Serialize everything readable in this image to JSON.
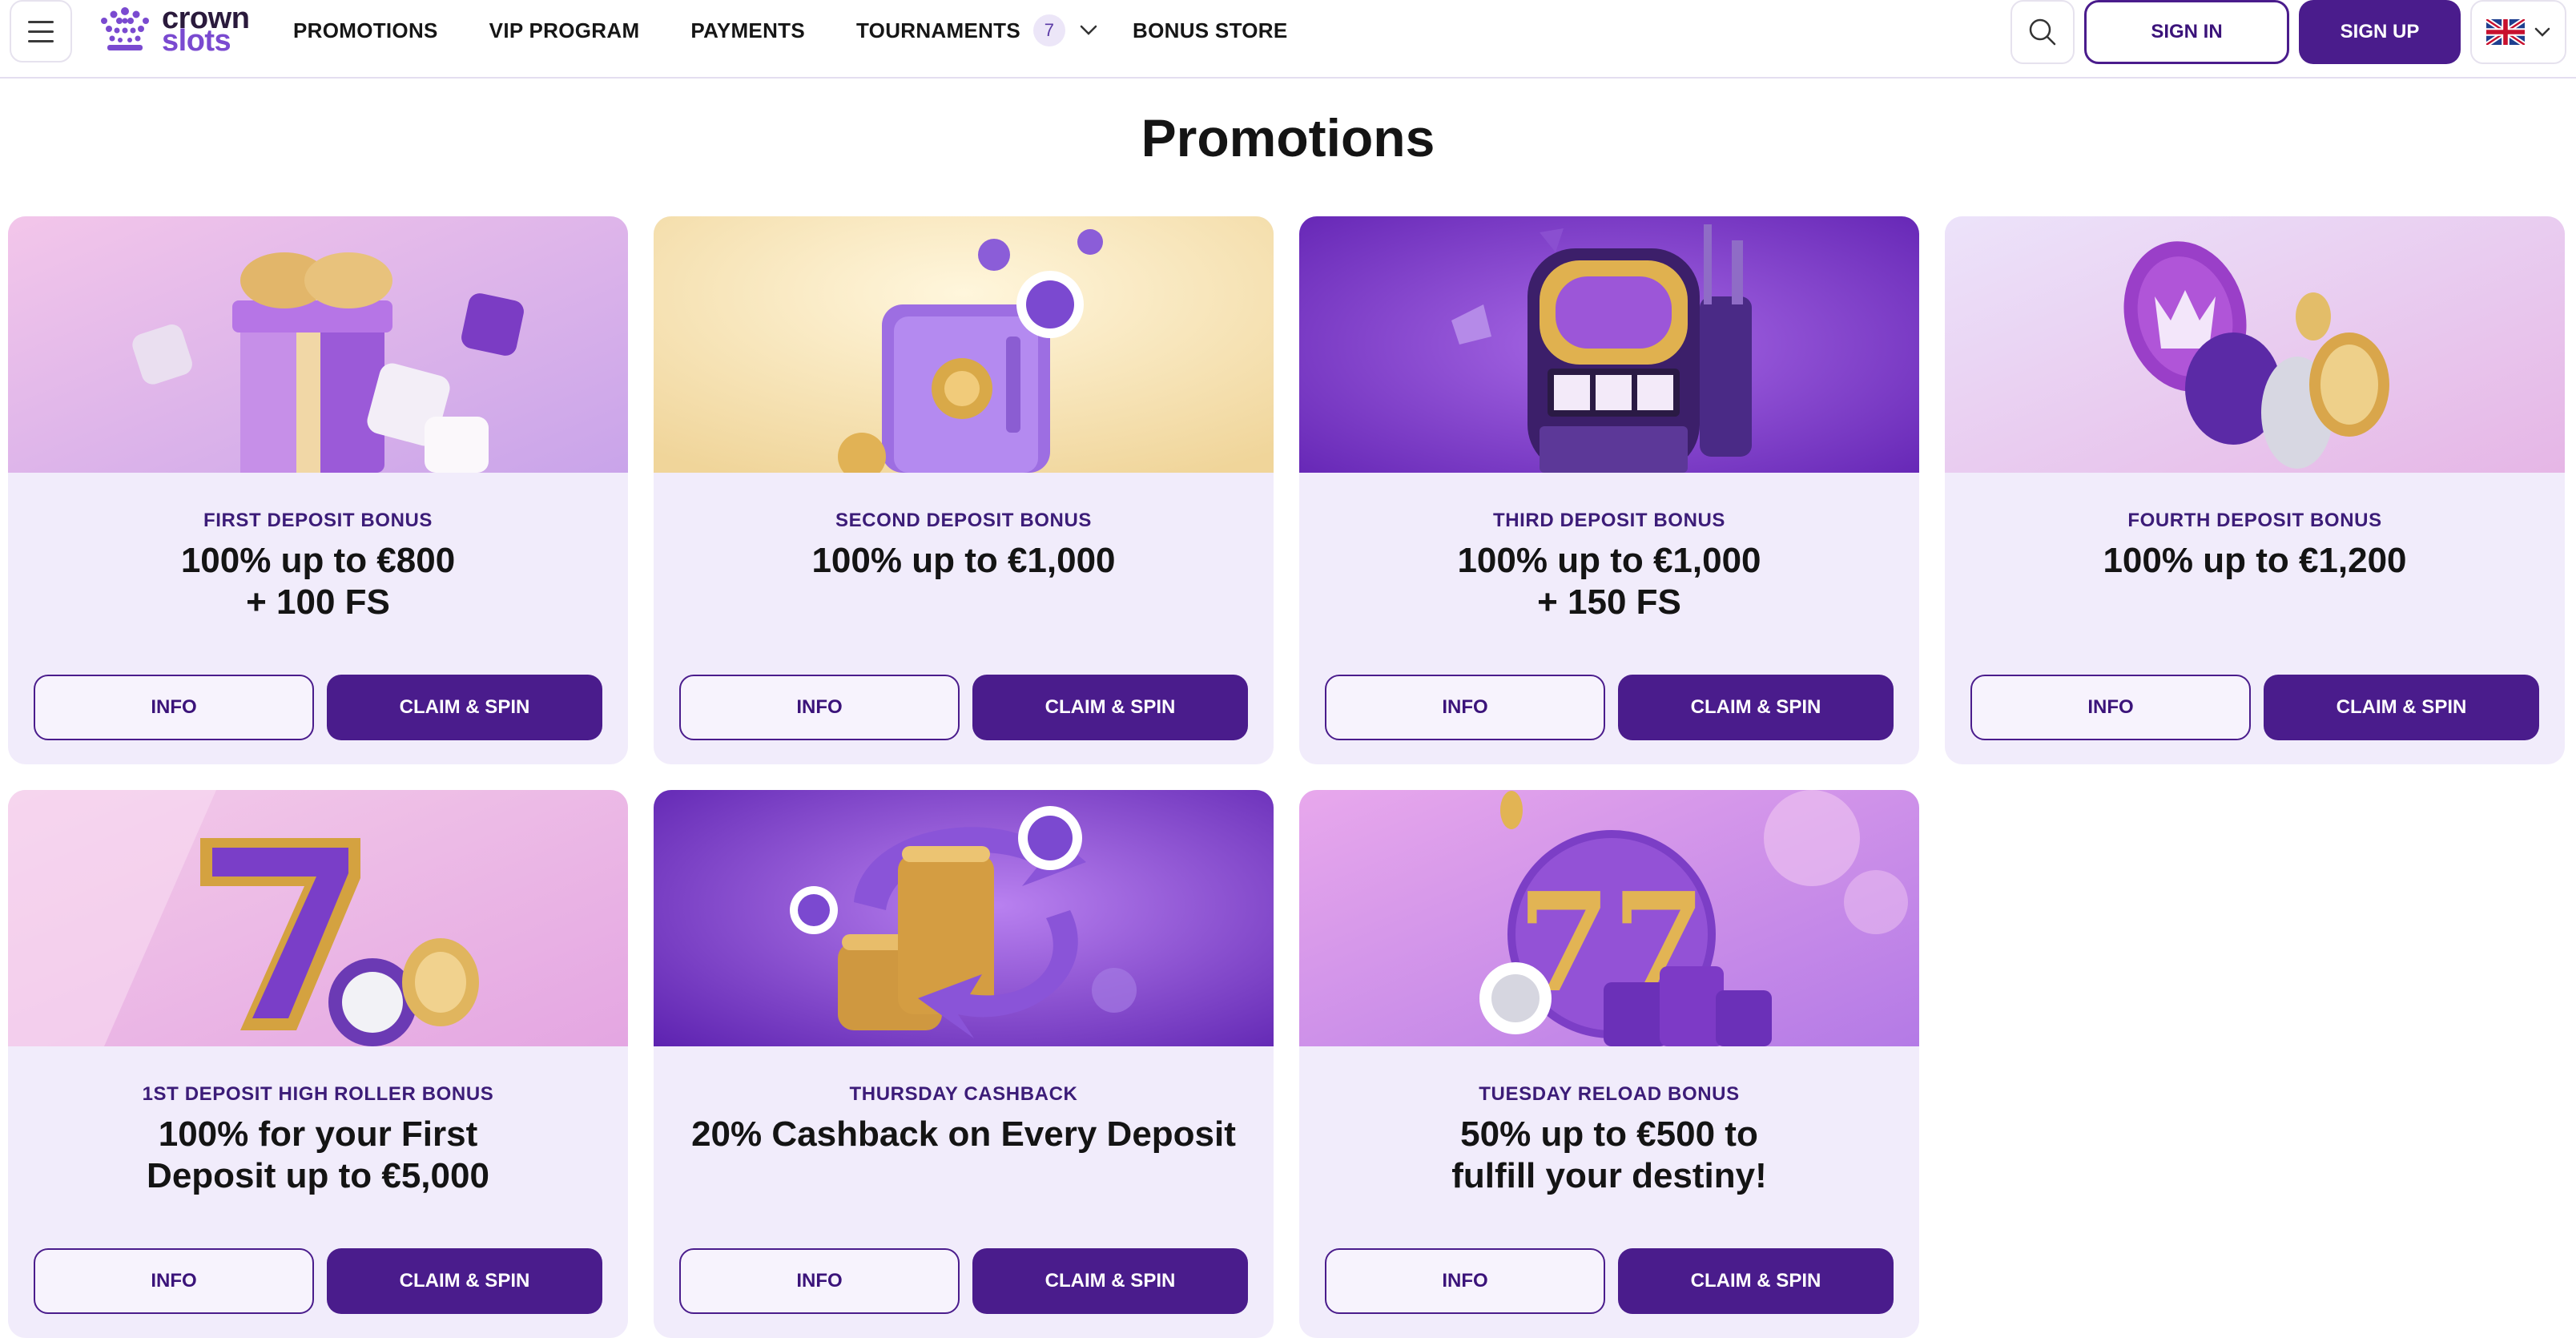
{
  "header": {
    "logo": {
      "line1": "crown",
      "line2": "slots"
    },
    "nav": [
      {
        "label": "PROMOTIONS"
      },
      {
        "label": "VIP PROGRAM"
      },
      {
        "label": "PAYMENTS"
      },
      {
        "label": "TOURNAMENTS",
        "count": "7"
      },
      {
        "label": "BONUS STORE"
      }
    ],
    "signin_label": "SIGN IN",
    "signup_label": "SIGN UP",
    "language_icon": "uk-flag-icon"
  },
  "page": {
    "title": "Promotions"
  },
  "promotions": [
    {
      "label": "FIRST DEPOSIT BONUS",
      "offer_l1": "100% up to €800",
      "offer_l2": "+ 100 FS",
      "info": "INFO",
      "claim": "CLAIM & SPIN",
      "image": "gift-box-dice"
    },
    {
      "label": "SECOND DEPOSIT BONUS",
      "offer_l1": "100% up to €1,000",
      "offer_l2": "",
      "info": "INFO",
      "claim": "CLAIM & SPIN",
      "image": "safe-chips"
    },
    {
      "label": "THIRD DEPOSIT BONUS",
      "offer_l1": "100% up to €1,000",
      "offer_l2": "+ 150 FS",
      "info": "INFO",
      "claim": "CLAIM & SPIN",
      "image": "slot-machine"
    },
    {
      "label": "FOURTH DEPOSIT BONUS",
      "offer_l1": "100% up to €1,200",
      "offer_l2": "",
      "info": "INFO",
      "claim": "CLAIM & SPIN",
      "image": "crown-coin-chips"
    },
    {
      "label": "1ST DEPOSIT HIGH ROLLER BONUS",
      "offer_l1": "100% for your First",
      "offer_l2": "Deposit up to €5,000",
      "info": "INFO",
      "claim": "CLAIM & SPIN",
      "image": "golden-seven"
    },
    {
      "label": "THURSDAY CASHBACK",
      "offer_l1": "20% Cashback on Every Deposit",
      "offer_l2": "",
      "info": "INFO",
      "claim": "CLAIM & SPIN",
      "image": "coin-stacks-arrows"
    },
    {
      "label": "TUESDAY RELOAD BONUS",
      "offer_l1": "50% up to €500 to",
      "offer_l2": "fulfill your destiny!",
      "info": "INFO",
      "claim": "CLAIM & SPIN",
      "image": "triple-seven-chips"
    }
  ],
  "colors": {
    "brand_purple": "#4a1c8c",
    "card_bg": "#f1ecfb",
    "label_purple": "#3c1c78"
  }
}
